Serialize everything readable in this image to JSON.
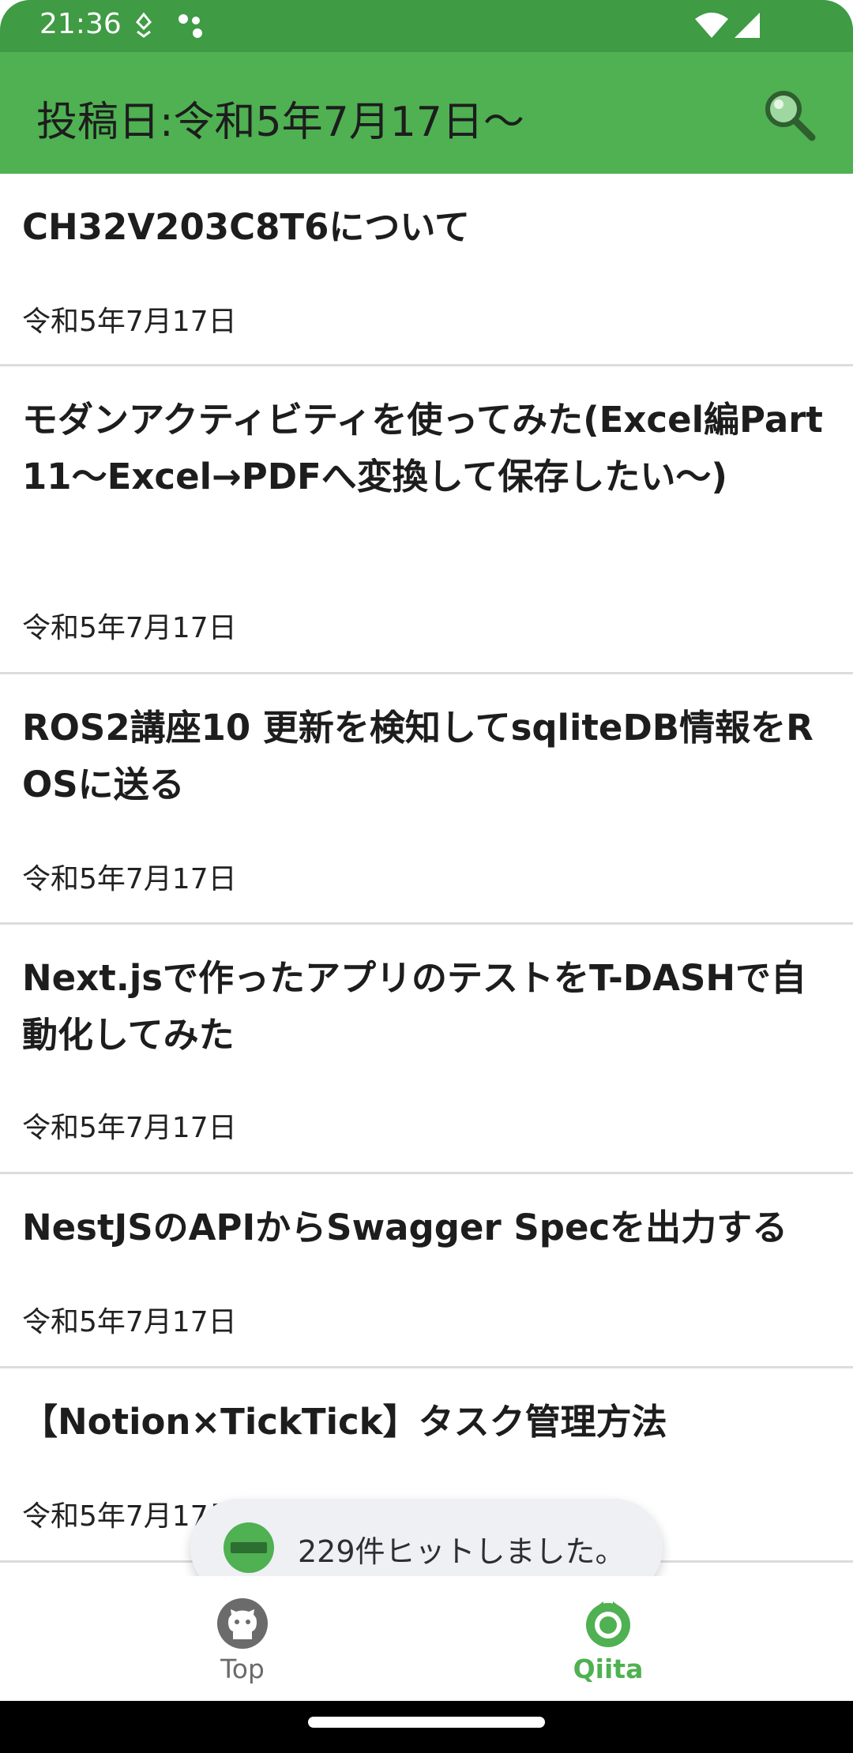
{
  "status_bar": {
    "time": "21:36",
    "icons": [
      "usb-debug-icon",
      "dots-icon",
      "wifi-icon",
      "cellular-signal-icon"
    ]
  },
  "app_bar": {
    "title": "投稿日:令和5年7月17日〜",
    "search_icon": "search-icon",
    "background_color": "#4fb152"
  },
  "articles": [
    {
      "title": "CH32V203C8T6について",
      "date": "令和5年7月17日"
    },
    {
      "title": "モダンアクティビティを使ってみた(Excel編Part11〜Excel→PDFへ変換して保存したい〜)",
      "date": "令和5年7月17日"
    },
    {
      "title": "ROS2講座10 更新を検知してsqliteDB情報をROSに送る",
      "date": "令和5年7月17日"
    },
    {
      "title": "Next.jsで作ったアプリのテストをT-DASHで自動化してみた",
      "date": "令和5年7月17日"
    },
    {
      "title": "NestJSのAPIからSwagger Specを出力する",
      "date": "令和5年7月17日"
    },
    {
      "title": "【Notion×TickTick】タスク管理方法",
      "date": "令和5年7月17日"
    }
  ],
  "toast": {
    "message": "229件ヒットしました。",
    "logo_icon": "app-logo-icon"
  },
  "bottom_nav": {
    "items": [
      {
        "label": "Top",
        "icon": "github-icon",
        "color": "#6b6b6b",
        "selected": false
      },
      {
        "label": "Qiita",
        "icon": "qiita-icon",
        "color": "#4fb152",
        "selected": true
      }
    ]
  }
}
